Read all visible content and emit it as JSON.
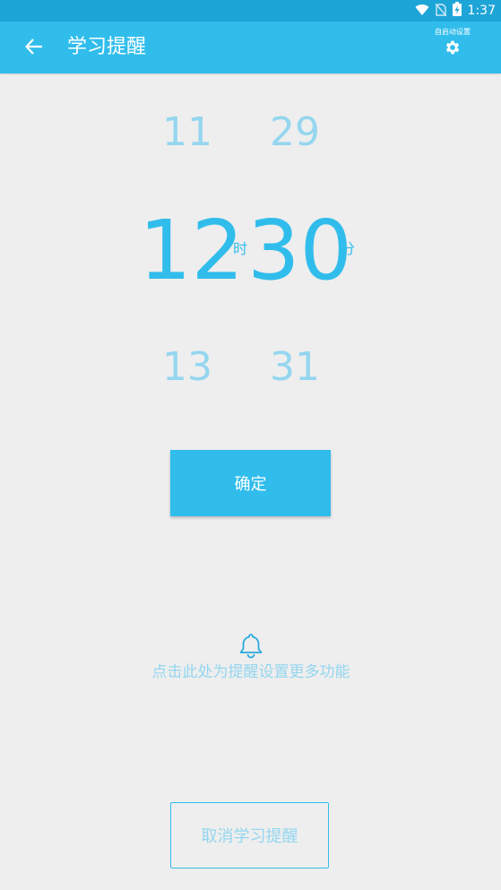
{
  "status_bar": {
    "time": "1:37",
    "icons": [
      "wifi-icon",
      "no-sim-icon",
      "battery-charging-icon"
    ]
  },
  "app_bar": {
    "title": "学习提醒",
    "back_icon": "arrow-left-icon",
    "settings_caption": "自启动设置",
    "settings_icon": "gear-icon"
  },
  "time_picker": {
    "hour_prev": "11",
    "hour_selected": "12",
    "hour_next": "13",
    "hour_unit": "时",
    "minute_prev": "29",
    "minute_selected": "30",
    "minute_next": "31",
    "minute_unit": "分"
  },
  "confirm_label": "确定",
  "more_settings": {
    "icon": "bell-icon",
    "text": "点击此处为提醒设置更多功能"
  },
  "cancel_label": "取消学习提醒",
  "colors": {
    "primary": "#31bdec",
    "status_bar": "#1ea5d8",
    "muted": "#94d6ef",
    "background": "#eeeeee"
  }
}
